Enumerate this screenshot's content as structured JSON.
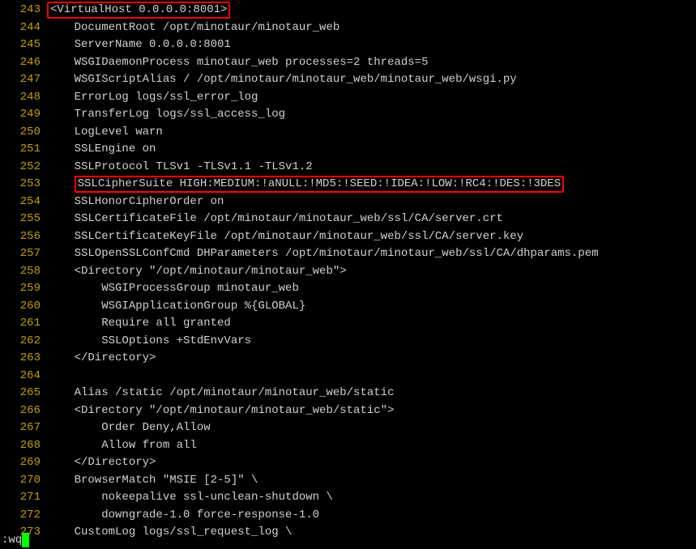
{
  "status_text": ":wq",
  "lines": [
    {
      "n": 243,
      "text": "<VirtualHost 0.0.0.0:8001>",
      "highlight": true,
      "indent": ""
    },
    {
      "n": 244,
      "text": "    DocumentRoot /opt/minotaur/minotaur_web"
    },
    {
      "n": 245,
      "text": "    ServerName 0.0.0.0:8001"
    },
    {
      "n": 246,
      "text": "    WSGIDaemonProcess minotaur_web processes=2 threads=5"
    },
    {
      "n": 247,
      "text": "    WSGIScriptAlias / /opt/minotaur/minotaur_web/minotaur_web/wsgi.py"
    },
    {
      "n": 248,
      "text": "    ErrorLog logs/ssl_error_log"
    },
    {
      "n": 249,
      "text": "    TransferLog logs/ssl_access_log"
    },
    {
      "n": 250,
      "text": "    LogLevel warn"
    },
    {
      "n": 251,
      "text": "    SSLEngine on"
    },
    {
      "n": 252,
      "text": "    SSLProtocol TLSv1 -TLSv1.1 -TLSv1.2"
    },
    {
      "n": 253,
      "text": "SSLCipherSuite HIGH:MEDIUM:!aNULL:!MD5:!SEED:!IDEA:!LOW:!RC4:!DES:!3DES",
      "highlight": true,
      "indent": "    "
    },
    {
      "n": 254,
      "text": "    SSLHonorCipherOrder on"
    },
    {
      "n": 255,
      "text": "    SSLCertificateFile /opt/minotaur/minotaur_web/ssl/CA/server.crt"
    },
    {
      "n": 256,
      "text": "    SSLCertificateKeyFile /opt/minotaur/minotaur_web/ssl/CA/server.key"
    },
    {
      "n": 257,
      "text": "    SSLOpenSSLConfCmd DHParameters /opt/minotaur/minotaur_web/ssl/CA/dhparams.pem"
    },
    {
      "n": 258,
      "text": "    <Directory \"/opt/minotaur/minotaur_web\">"
    },
    {
      "n": 259,
      "text": "        WSGIProcessGroup minotaur_web"
    },
    {
      "n": 260,
      "text": "        WSGIApplicationGroup %{GLOBAL}"
    },
    {
      "n": 261,
      "text": "        Require all granted"
    },
    {
      "n": 262,
      "text": "        SSLOptions +StdEnvVars"
    },
    {
      "n": 263,
      "text": "    </Directory>"
    },
    {
      "n": 264,
      "text": ""
    },
    {
      "n": 265,
      "text": "    Alias /static /opt/minotaur/minotaur_web/static"
    },
    {
      "n": 266,
      "text": "    <Directory \"/opt/minotaur/minotaur_web/static\">"
    },
    {
      "n": 267,
      "text": "        Order Deny,Allow"
    },
    {
      "n": 268,
      "text": "        Allow from all"
    },
    {
      "n": 269,
      "text": "    </Directory>"
    },
    {
      "n": 270,
      "text": "    BrowserMatch \"MSIE [2-5]\" \\"
    },
    {
      "n": 271,
      "text": "        nokeepalive ssl-unclean-shutdown \\"
    },
    {
      "n": 272,
      "text": "        downgrade-1.0 force-response-1.0"
    },
    {
      "n": 273,
      "text": "    CustomLog logs/ssl_request_log \\"
    }
  ]
}
